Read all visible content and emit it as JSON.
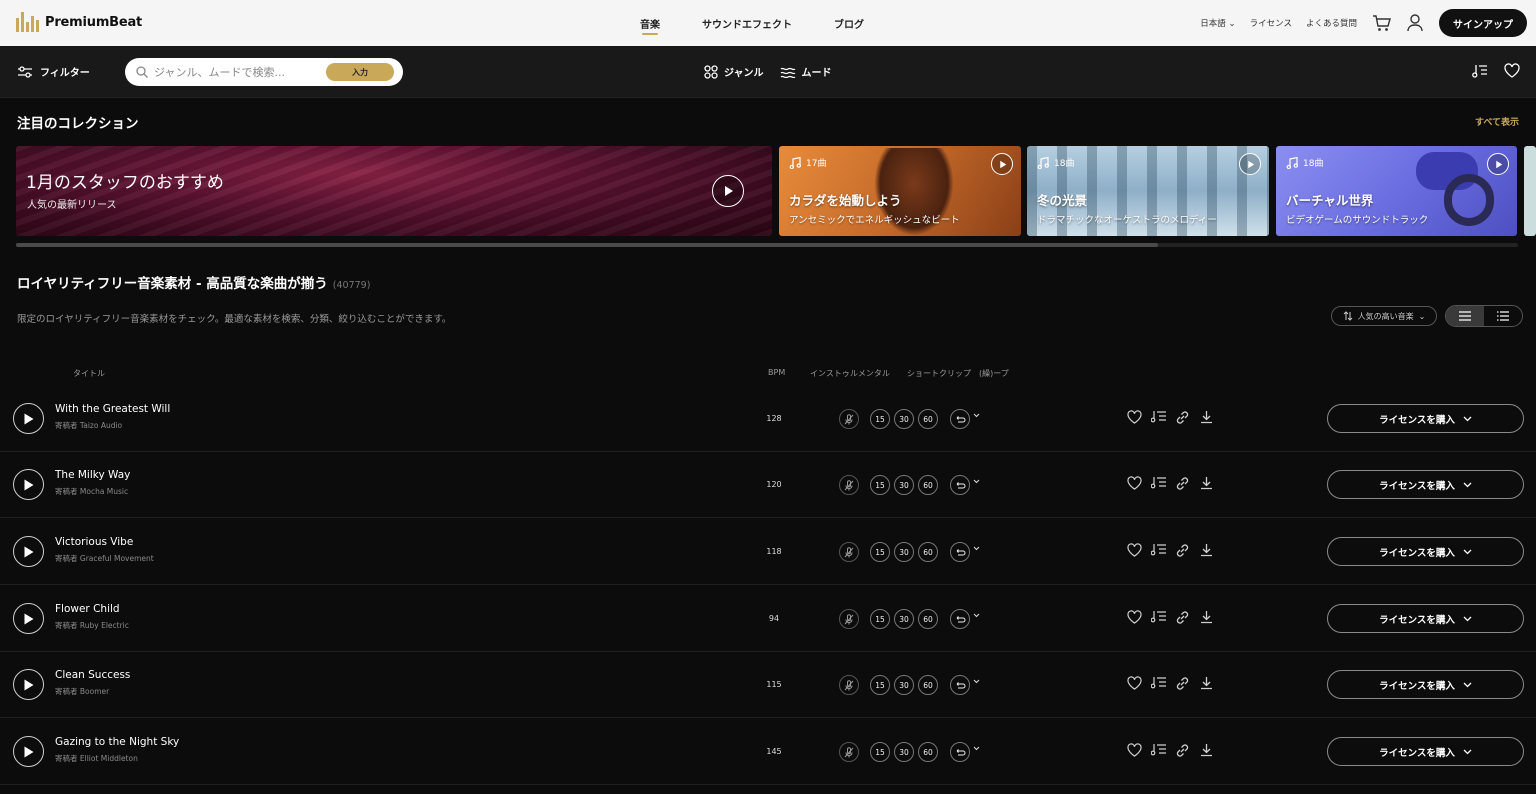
{
  "brand": {
    "name": "PremiumBeat",
    "accent": "#c9a85a"
  },
  "nav": {
    "center": [
      {
        "label": "音楽",
        "active": true
      },
      {
        "label": "サウンドエフェクト",
        "active": false
      },
      {
        "label": "ブログ",
        "active": false
      }
    ],
    "language": "日本語",
    "license": "ライセンス",
    "faq": "よくある質問",
    "signup": "サインアップ"
  },
  "toolbar": {
    "filter_label": "フィルター",
    "search_placeholder": "ジャンル、ムードで検索...",
    "enter_label": "入力",
    "genre_label": "ジャンル",
    "mood_label": "ムード"
  },
  "featured": {
    "title": "注目のコレクション",
    "see_all": "すべて表示",
    "hero": {
      "title": "1月のスタッフのおすすめ",
      "subtitle": "人気の最新リリース"
    },
    "cards": [
      {
        "count": "17曲",
        "title": "カラダを始動しよう",
        "subtitle": "アンセミックでエネルギッシュなビート"
      },
      {
        "count": "18曲",
        "title": "冬の光景",
        "subtitle": "ドラマチックなオーケストラのメロディー"
      },
      {
        "count": "18曲",
        "title": "バーチャル世界",
        "subtitle": "ビデオゲームのサウンドトラック"
      }
    ]
  },
  "library": {
    "title": "ロイヤリティフリー音楽素材 - 高品質な楽曲が揃う",
    "count": "(40779)",
    "description": "限定のロイヤリティフリー音楽素材をチェック。最適な素材を検索、分類、絞り込むことができます。",
    "sort_label": "人気の高い音楽",
    "columns": {
      "title": "タイトル",
      "bpm": "BPM",
      "instrumental": "インストゥルメンタル",
      "shortclip": "ショートクリップ",
      "loop": "(繰)ープ"
    },
    "clip_lengths": [
      "15",
      "30",
      "60"
    ],
    "license_label": "ライセンスを購入",
    "tracks": [
      {
        "title": "With the Greatest Will",
        "artist": "寄稿者 Taizo Audio",
        "bpm": "128"
      },
      {
        "title": "The Milky Way",
        "artist": "寄稿者 Mocha Music",
        "bpm": "120"
      },
      {
        "title": "Victorious Vibe",
        "artist": "寄稿者 Graceful Movement",
        "bpm": "118"
      },
      {
        "title": "Flower Child",
        "artist": "寄稿者 Ruby Electric",
        "bpm": "94"
      },
      {
        "title": "Clean Success",
        "artist": "寄稿者 Boomer",
        "bpm": "115"
      },
      {
        "title": "Gazing to the Night Sky",
        "artist": "寄稿者 Elliot Middleton",
        "bpm": "145"
      }
    ]
  }
}
